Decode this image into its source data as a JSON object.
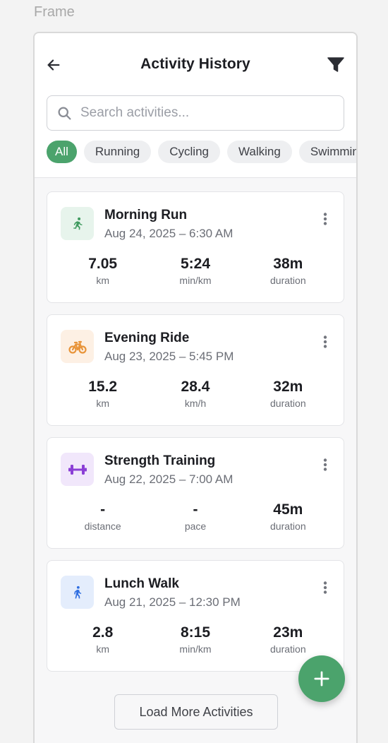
{
  "frame_label": "Frame",
  "header": {
    "title": "Activity History"
  },
  "search": {
    "placeholder": "Search activities...",
    "value": ""
  },
  "filters": [
    {
      "label": "All",
      "active": true
    },
    {
      "label": "Running",
      "active": false
    },
    {
      "label": "Cycling",
      "active": false
    },
    {
      "label": "Walking",
      "active": false
    },
    {
      "label": "Swimming",
      "active": false
    }
  ],
  "activities": [
    {
      "name": "Morning Run",
      "date": "Aug 24, 2025 – 6:30 AM",
      "icon": "running-icon",
      "icon_color": "#3f9a5f",
      "icon_bg": "#e7f4ec",
      "stats": [
        {
          "value": "7.05",
          "unit": "km"
        },
        {
          "value": "5:24",
          "unit": "min/km"
        },
        {
          "value": "38m",
          "unit": "duration"
        }
      ]
    },
    {
      "name": "Evening Ride",
      "date": "Aug 23, 2025 – 5:45 PM",
      "icon": "bicycle-icon",
      "icon_color": "#e8943a",
      "icon_bg": "#fdf0e4",
      "stats": [
        {
          "value": "15.2",
          "unit": "km"
        },
        {
          "value": "28.4",
          "unit": "km/h"
        },
        {
          "value": "32m",
          "unit": "duration"
        }
      ]
    },
    {
      "name": "Strength Training",
      "date": "Aug 22, 2025 – 7:00 AM",
      "icon": "dumbbell-icon",
      "icon_color": "#8b3fd6",
      "icon_bg": "#f1e7fb",
      "stats": [
        {
          "value": "-",
          "unit": "distance"
        },
        {
          "value": "-",
          "unit": "pace"
        },
        {
          "value": "45m",
          "unit": "duration"
        }
      ]
    },
    {
      "name": "Lunch Walk",
      "date": "Aug 21, 2025 – 12:30 PM",
      "icon": "walking-icon",
      "icon_color": "#2f6ee0",
      "icon_bg": "#e4edfc",
      "stats": [
        {
          "value": "2.8",
          "unit": "km"
        },
        {
          "value": "8:15",
          "unit": "min/km"
        },
        {
          "value": "23m",
          "unit": "duration"
        }
      ]
    }
  ],
  "load_more_label": "Load More Activities",
  "colors": {
    "accent": "#4ba36c"
  }
}
